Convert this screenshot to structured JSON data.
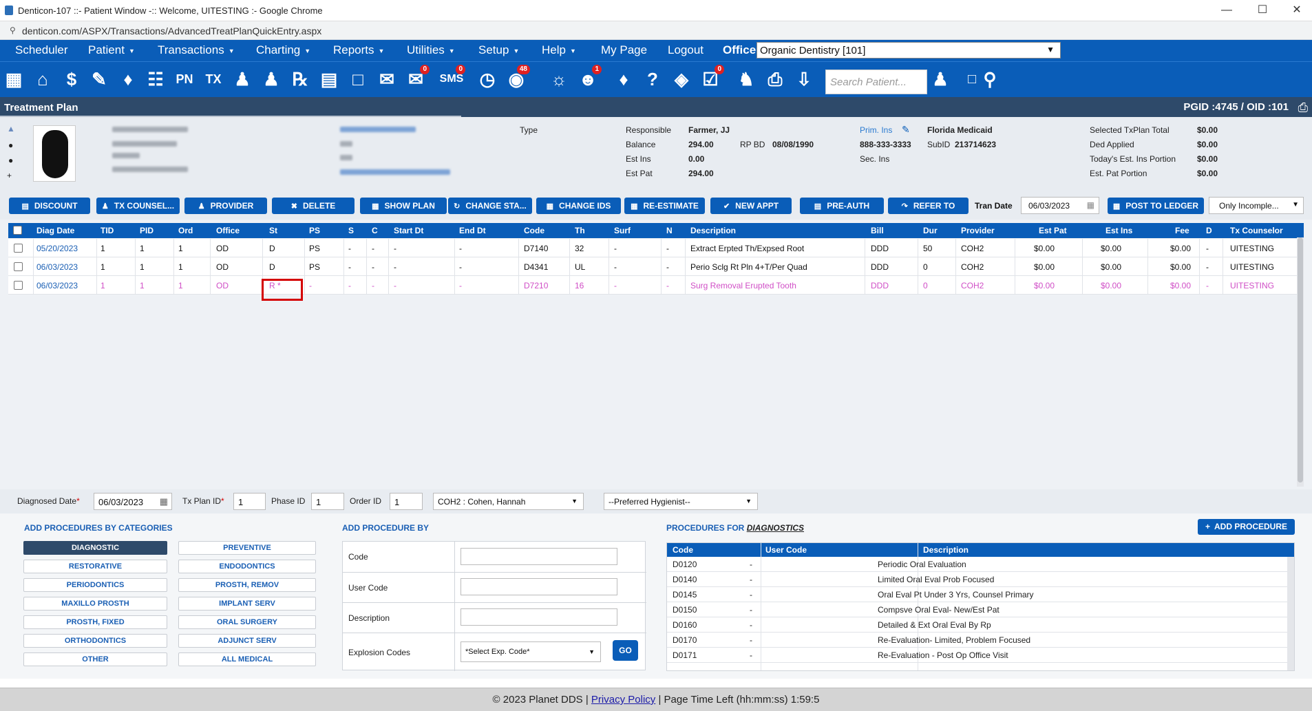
{
  "browser": {
    "window_title": "Denticon-107 ::- Patient Window -:: Welcome, UITESTING :- Google Chrome",
    "url": "denticon.com/ASPX/Transactions/AdvancedTreatPlanQuickEntry.aspx"
  },
  "menu": {
    "items": [
      "Scheduler",
      "Patient",
      "Transactions",
      "Charting",
      "Reports",
      "Utilities",
      "Setup",
      "Help",
      "My Page",
      "Logout"
    ],
    "office_label": "Office",
    "office_value": "Organic Dentistry [101]"
  },
  "toolbar": {
    "search_placeholder": "Search Patient...",
    "badges": {
      "sms": "0",
      "msg": "0",
      "web": "48",
      "alert": "1",
      "rx": "0"
    }
  },
  "header": {
    "title": "Treatment Plan",
    "ids": "PGID :4745  /  OID :101"
  },
  "patient": {
    "type_label": "Type",
    "responsible_label": "Responsible",
    "responsible_value": "Farmer, JJ",
    "balance_label": "Balance",
    "balance_value": "294.00",
    "rpbd_label": "RP BD",
    "rpbd_value": "08/08/1990",
    "est_ins_label": "Est Ins",
    "est_ins_value": "0.00",
    "est_pat_label": "Est Pat",
    "est_pat_value": "294.00",
    "prim_ins_label": "Prim. Ins",
    "prim_ins_value": "Florida Medicaid",
    "phone": "888-333-3333",
    "subid_label": "SubID",
    "subid_value": "213714623",
    "sec_ins_label": "Sec. Ins",
    "summary": [
      {
        "label": "Selected TxPlan Total",
        "value": "$0.00"
      },
      {
        "label": "Ded Applied",
        "value": "$0.00"
      },
      {
        "label": "Today's Est. Ins Portion",
        "value": "$0.00"
      },
      {
        "label": "Est. Pat Portion",
        "value": "$0.00"
      }
    ]
  },
  "actions": {
    "buttons": [
      "DISCOUNT",
      "TX COUNSEL...",
      "PROVIDER",
      "DELETE",
      "SHOW PLAN",
      "CHANGE STA...",
      "CHANGE IDS",
      "RE-ESTIMATE",
      "NEW APPT",
      "PRE-AUTH",
      "REFER TO"
    ],
    "tran_date_label": "Tran Date",
    "tran_date_value": "06/03/2023",
    "post_button": "POST TO LEDGER",
    "filter_value": "Only Incomple..."
  },
  "grid": {
    "columns": [
      "Diag Date",
      "TID",
      "PID",
      "Ord",
      "Office",
      "St",
      "PS",
      "S",
      "C",
      "Start Dt",
      "End Dt",
      "Code",
      "Th",
      "Surf",
      "N",
      "Description",
      "Bill",
      "Dur",
      "Provider",
      "Est Pat",
      "Est Ins",
      "Fee",
      "D",
      "Tx Counselor"
    ],
    "rows": [
      {
        "diag_date": "05/20/2023",
        "tid": "1",
        "pid": "1",
        "ord": "1",
        "office": "OD",
        "st": "D",
        "ps": "PS",
        "s": "-",
        "c": "-",
        "start": "-",
        "end": "-",
        "code": "D7140",
        "th": "32",
        "surf": "-",
        "n": "-",
        "desc": "Extract Erpted Th/Expsed Root",
        "bill": "DDD",
        "dur": "50",
        "provider": "COH2",
        "est_pat": "$0.00",
        "est_ins": "$0.00",
        "fee": "$0.00",
        "d": "-",
        "counselor": "UITESTING"
      },
      {
        "diag_date": "06/03/2023",
        "tid": "1",
        "pid": "1",
        "ord": "1",
        "office": "OD",
        "st": "D",
        "ps": "PS",
        "s": "-",
        "c": "-",
        "start": "-",
        "end": "-",
        "code": "D4341",
        "th": "UL",
        "surf": "-",
        "n": "-",
        "desc": "Perio Sclg Rt Pln 4+T/Per Quad",
        "bill": "DDD",
        "dur": "0",
        "provider": "COH2",
        "est_pat": "$0.00",
        "est_ins": "$0.00",
        "fee": "$0.00",
        "d": "-",
        "counselor": "UITESTING"
      },
      {
        "diag_date": "06/03/2023",
        "tid": "1",
        "pid": "1",
        "ord": "1",
        "office": "OD",
        "st": "R *",
        "ps": "-",
        "s": "-",
        "c": "-",
        "start": "-",
        "end": "-",
        "code": "D7210",
        "th": "16",
        "surf": "-",
        "n": "-",
        "desc": "Surg Removal Erupted Tooth",
        "bill": "DDD",
        "dur": "0",
        "provider": "COH2",
        "est_pat": "$0.00",
        "est_ins": "$0.00",
        "fee": "$0.00",
        "d": "-",
        "counselor": "UITESTING"
      }
    ]
  },
  "entry": {
    "diag_date_label": "Diagnosed Date",
    "diag_date_value": "06/03/2023",
    "txplan_label": "Tx Plan ID",
    "txplan_value": "1",
    "phase_label": "Phase ID",
    "phase_value": "1",
    "order_label": "Order ID",
    "order_value": "1",
    "provider_value": "COH2 : Cohen, Hannah",
    "hygienist_value": "--Preferred Hygienist--"
  },
  "bottom": {
    "categories_title": "ADD PROCEDURES BY CATEGORIES",
    "categories": [
      "DIAGNOSTIC",
      "PREVENTIVE",
      "RESTORATIVE",
      "ENDODONTICS",
      "PERIODONTICS",
      "PROSTH, REMOV",
      "MAXILLO PROSTH",
      "IMPLANT SERV",
      "PROSTH, FIXED",
      "ORAL SURGERY",
      "ORTHODONTICS",
      "ADJUNCT SERV",
      "OTHER",
      "ALL MEDICAL"
    ],
    "add_by_title": "ADD PROCEDURE BY",
    "add_by_fields": [
      "Code",
      "User Code",
      "Description",
      "Explosion Codes"
    ],
    "explosion_value": "*Select Exp. Code*",
    "go_label": "GO",
    "procedures_title": "PROCEDURES FOR",
    "procedures_for": "DIAGNOSTICS",
    "add_procedure": "ADD PROCEDURE",
    "proc_columns": [
      "Code",
      "User Code",
      "Description"
    ],
    "procedures": [
      {
        "code": "D0120",
        "user": "-",
        "desc": "Periodic Oral Evaluation"
      },
      {
        "code": "D0140",
        "user": "-",
        "desc": "Limited Oral Eval Prob Focused"
      },
      {
        "code": "D0145",
        "user": "-",
        "desc": "Oral Eval Pt Under 3 Yrs, Counsel Primary"
      },
      {
        "code": "D0150",
        "user": "-",
        "desc": "Compsve Oral Eval- New/Est Pat"
      },
      {
        "code": "D0160",
        "user": "-",
        "desc": "Detailed & Ext Oral Eval By Rp"
      },
      {
        "code": "D0170",
        "user": "-",
        "desc": "Re-Evaluation- Limited, Problem Focused"
      },
      {
        "code": "D0171",
        "user": "-",
        "desc": "Re-Evaluation - Post Op Office Visit"
      }
    ]
  },
  "footer": {
    "copyright": "© 2023 Planet DDS",
    "privacy": "Privacy Policy",
    "time_left": "Page Time Left (hh:mm:ss) 1:59:5"
  }
}
